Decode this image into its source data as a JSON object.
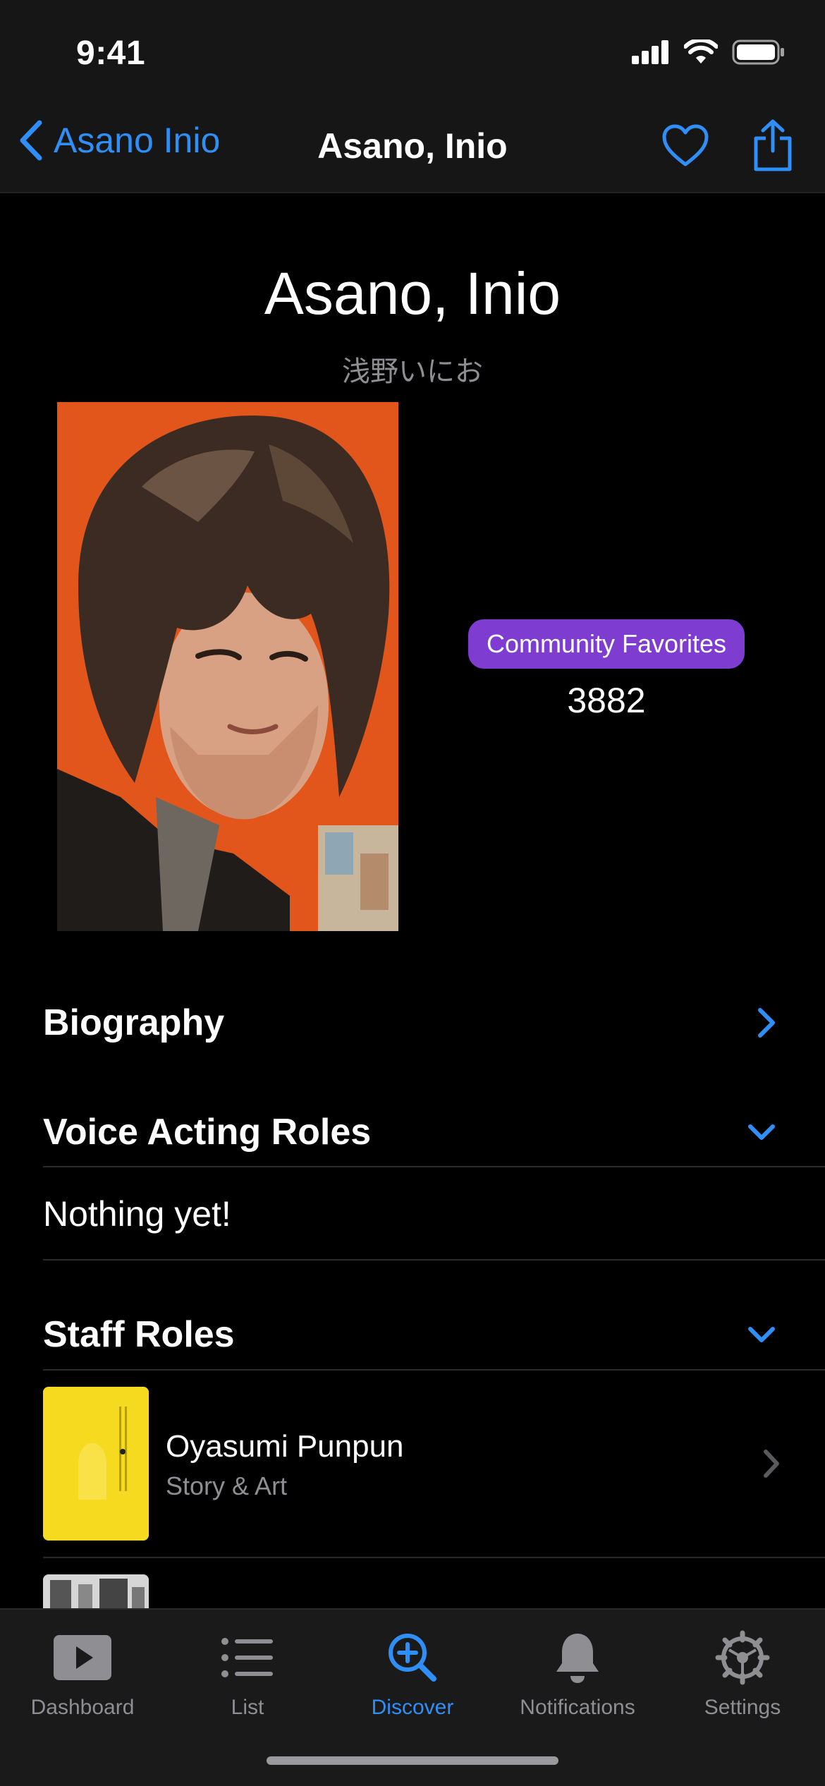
{
  "status_bar": {
    "time": "9:41"
  },
  "nav": {
    "back_label": "Asano Inio",
    "title": "Asano, Inio",
    "icons": [
      "heart-icon",
      "share-icon"
    ]
  },
  "person": {
    "name": "Asano, Inio",
    "native_name": "浅野いにお",
    "favorites_label": "Community Favorites",
    "favorites_count": "3882"
  },
  "sections": {
    "biography": {
      "title": "Biography"
    },
    "voice_acting": {
      "title": "Voice Acting Roles",
      "empty_text": "Nothing yet!"
    },
    "staff": {
      "title": "Staff Roles",
      "items": [
        {
          "title": "Oyasumi Punpun",
          "role": "Story & Art"
        }
      ]
    }
  },
  "tabbar": {
    "items": [
      {
        "label": "Dashboard",
        "icon": "play-icon"
      },
      {
        "label": "List",
        "icon": "list-icon"
      },
      {
        "label": "Discover",
        "icon": "search-plus-icon",
        "active": true
      },
      {
        "label": "Notifications",
        "icon": "bell-icon"
      },
      {
        "label": "Settings",
        "icon": "gear-icon"
      }
    ]
  },
  "colors": {
    "accent": "#2f8ff7",
    "badge": "#7e3dd0",
    "background": "#000000",
    "bar": "#1a1a1b"
  }
}
